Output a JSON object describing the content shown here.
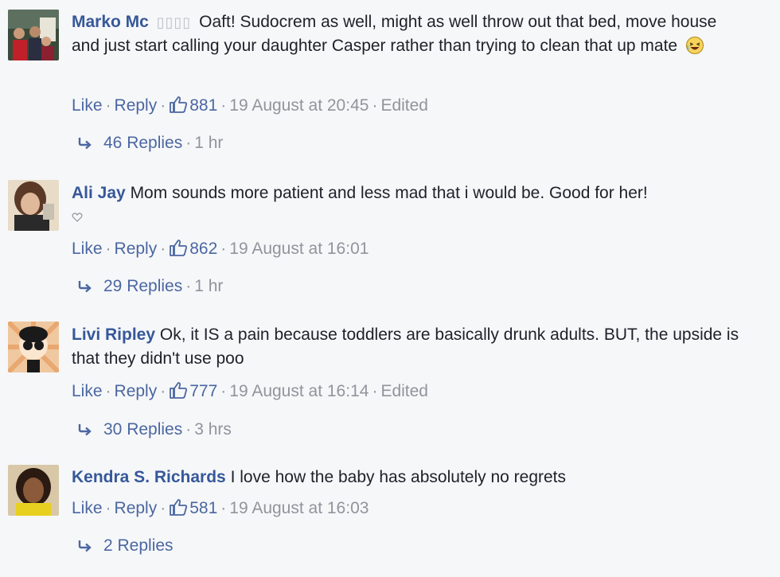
{
  "comments": [
    {
      "author": "Marko Mc",
      "placeholder": "▯▯▯▯",
      "text": "Oaft! Sudocrem as well, might as well throw out that bed, move house and just start calling your daughter Casper rather than trying to clean that up mate",
      "like": "Like",
      "reply": "Reply",
      "likes": "881",
      "time": "19 August at 20:45",
      "edited": "Edited",
      "replies": "46 Replies",
      "replies_time": "1 hr"
    },
    {
      "author": "Ali Jay",
      "text": "Mom sounds more patient and less mad that i would be. Good for her!",
      "like": "Like",
      "reply": "Reply",
      "likes": "862",
      "time": "19 August at 16:01",
      "replies": "29 Replies",
      "replies_time": "1 hr"
    },
    {
      "author": "Livi Ripley",
      "text": "Ok, it IS a pain because toddlers are basically drunk adults. BUT, the upside is that they didn't use poo",
      "like": "Like",
      "reply": "Reply",
      "likes": "777",
      "time": "19 August at 16:14",
      "edited": "Edited",
      "replies": "30 Replies",
      "replies_time": "3 hrs"
    },
    {
      "author": "Kendra S. Richards",
      "text": "I love how the baby has absolutely no regrets",
      "like": "Like",
      "reply": "Reply",
      "likes": "581",
      "time": "19 August at 16:03",
      "replies": "2 Replies"
    }
  ],
  "separator": "·",
  "icons": {
    "like": "thumbs-up-icon",
    "reply_arrow": "reply-arrow-icon",
    "laugh": "laughing-emoji-icon",
    "heart": "heart-icon"
  },
  "colors": {
    "link": "#365899",
    "muted": "#90949c",
    "background": "#f6f7f9"
  }
}
